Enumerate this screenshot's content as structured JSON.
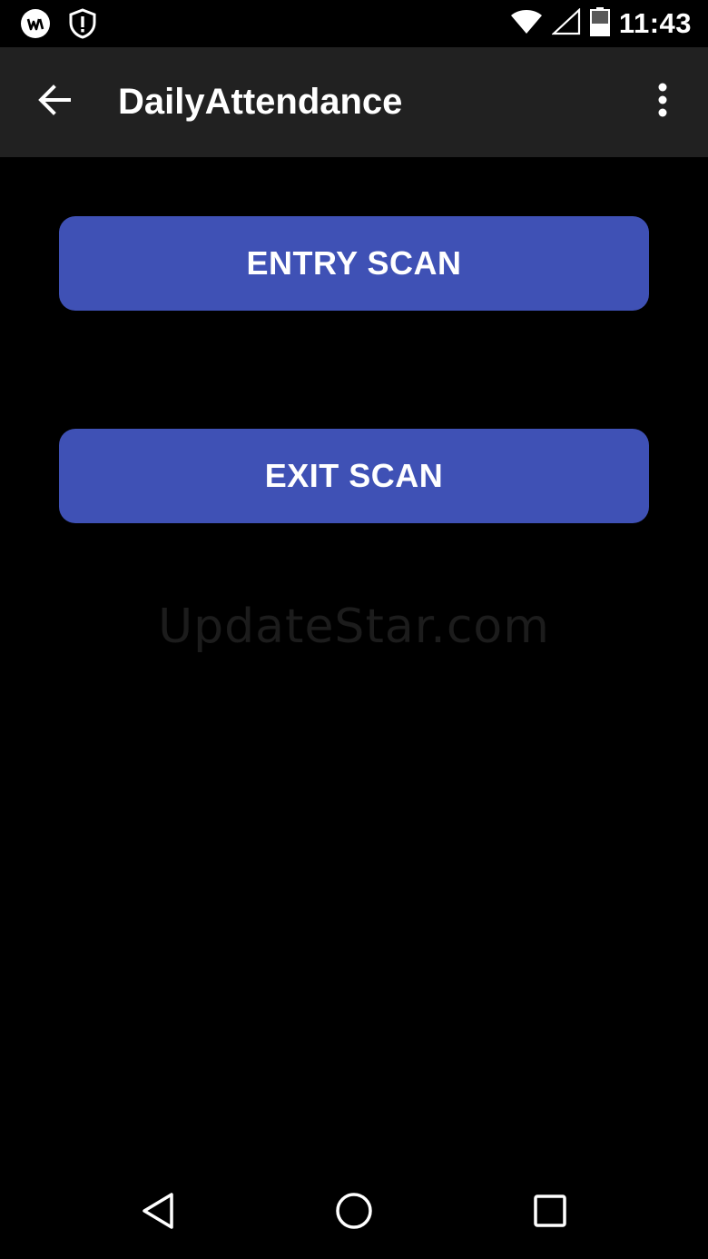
{
  "status_bar": {
    "time": "11:43",
    "left_icons": [
      "notification-app-icon",
      "shield-alert-icon"
    ],
    "right_icons": [
      "wifi-icon",
      "cell-signal-icon",
      "battery-icon"
    ]
  },
  "app_bar": {
    "title": "DailyAttendance",
    "back_icon": "arrow-back-icon",
    "menu_icon": "more-vert-icon"
  },
  "main": {
    "entry_scan_label": "ENTRY SCAN",
    "exit_scan_label": "EXIT SCAN",
    "watermark": "UpdateStar.com"
  },
  "nav_bar": {
    "icons": [
      "nav-back-icon",
      "nav-home-icon",
      "nav-recents-icon"
    ]
  },
  "colors": {
    "background": "#000000",
    "app_bar": "#212121",
    "accent": "#3f51b5",
    "text": "#ffffff"
  }
}
